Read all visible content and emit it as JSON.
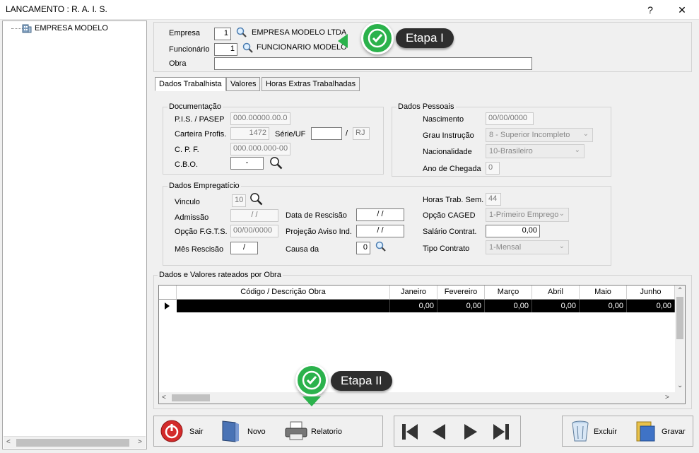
{
  "window": {
    "title": "LANCAMENTO : R. A. I. S.",
    "help": "?",
    "close": "✕"
  },
  "tree": {
    "root": "EMPRESA MODELO"
  },
  "header": {
    "empresa_label": "Empresa",
    "empresa_code": "1",
    "empresa_name": "EMPRESA MODELO LTDA",
    "funcionario_label": "Funcionário",
    "funcionario_code": "1",
    "funcionario_name": "FUNCIONARIO MODELO",
    "obra_label": "Obra",
    "obra_value": ""
  },
  "tabs": [
    "Dados Trabalhista",
    "Valores",
    "Horas Extras Trabalhadas"
  ],
  "documentacao": {
    "title": "Documentação",
    "pis_label": "P.I.S. / PASEP",
    "pis_value": "000.00000.00.0",
    "carteira_label": "Carteira Profis.",
    "carteira_value": "1472",
    "serie_label": "Série/UF",
    "serie_value": "",
    "slash": "/",
    "uf_value": "RJ",
    "cpf_label": "C. P. F.",
    "cpf_value": "000.000.000-00",
    "cbo_label": "C.B.O.",
    "cbo_value": "-"
  },
  "pessoais": {
    "title": "Dados Pessoais",
    "nascimento_label": "Nascimento",
    "nascimento_value": "00/00/0000",
    "grau_label": "Grau Instrução",
    "grau_value": "8 - Superior Incompleto",
    "nacionalidade_label": "Nacionalidade",
    "nacionalidade_value": "10-Brasileiro",
    "ano_label": "Ano de Chegada",
    "ano_value": "0"
  },
  "empregaticio": {
    "title": "Dados Empregatício",
    "vinculo_label": "Vinculo",
    "vinculo_value": "10",
    "admissao_label": "Admissão",
    "admissao_value": "/ /",
    "rescisao_label": "Data de Rescisão",
    "rescisao_value": "/ /",
    "fgts_label": "Opção F.G.T.S.",
    "fgts_value": "00/00/0000",
    "aviso_label": "Projeção Aviso Ind.",
    "aviso_value": "/ /",
    "mes_label": "Mês Rescisão",
    "mes_value": "/",
    "causa_label": "Causa da",
    "causa_value": "0",
    "horas_label": "Horas Trab. Sem.",
    "horas_value": "44",
    "caged_label": "Opção CAGED",
    "caged_value": "1-Primeiro Emprego",
    "salario_label": "Salário Contrat.",
    "salario_value": "0,00",
    "tipo_label": "Tipo Contrato",
    "tipo_value": "1-Mensal"
  },
  "rateio": {
    "title": "Dados e Valores rateados por Obra",
    "columns": [
      "Código / Descrição Obra",
      "Janeiro",
      "Fevereiro",
      "Março",
      "Abril",
      "Maio",
      "Junho"
    ],
    "row": [
      "",
      "0,00",
      "0,00",
      "0,00",
      "0,00",
      "0,00",
      "0,00"
    ]
  },
  "buttons": {
    "sair": "Sair",
    "novo": "Novo",
    "relatorio": "Relatorio",
    "excluir": "Excluir",
    "gravar": "Gravar"
  },
  "callouts": {
    "etapa1": "Etapa I",
    "etapa2": "Etapa II"
  },
  "colors": {
    "callout_green": "#2bb24c",
    "callout_dark": "#2e2e2e",
    "selection": "#000000"
  }
}
